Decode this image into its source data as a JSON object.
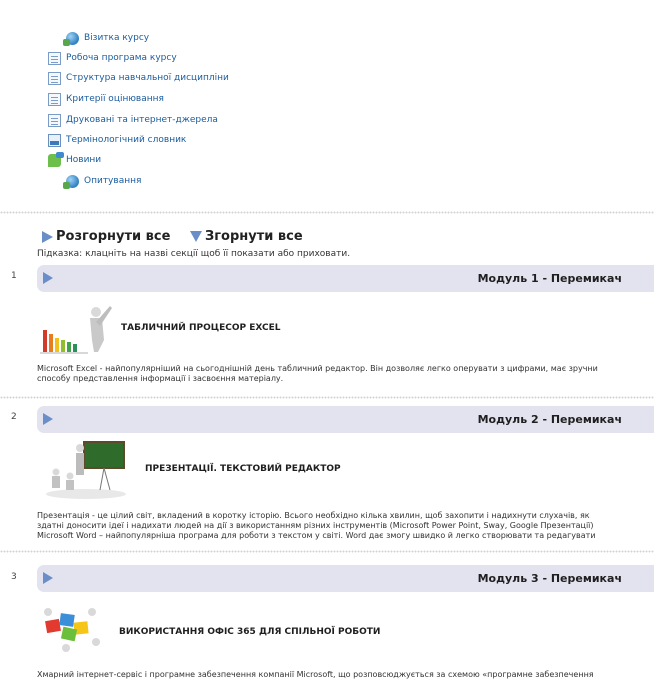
{
  "resources": [
    {
      "label": "Візитка курсу",
      "icon": "globe-icon"
    },
    {
      "label": "Робоча програма курсу",
      "icon": "document-icon"
    },
    {
      "label": "Структура навчальної дисципліни",
      "icon": "document-icon"
    },
    {
      "label": "Критерії оцінювання",
      "icon": "document-icon"
    },
    {
      "label": "Друковані та інтернет-джерела",
      "icon": "document-icon"
    },
    {
      "label": "Термінологічний словник",
      "icon": "glossary-icon"
    },
    {
      "label": "Новини",
      "icon": "forum-icon"
    },
    {
      "label": "Опитування",
      "icon": "globe-icon"
    }
  ],
  "controls": {
    "expand_all": "Розгорнути все",
    "collapse_all": "Згорнути все",
    "hint": "Підказка: клацніть на назві секції щоб її показати або приховати."
  },
  "sections": [
    {
      "number": "1",
      "title": "Модуль 1 - Перемикач",
      "heading": "ТАБЛИЧНИЙ ПРОЦЕСОР EXCEL",
      "description_lines": [
        "Microsoft Excel - найпопулярніший на сьогоднішній день табличний редактор. Він дозволяє легко оперувати з цифрами, має зручни",
        "способу представлення інформації і засвоєння матеріалу."
      ]
    },
    {
      "number": "2",
      "title": "Модуль 2 - Перемикач",
      "heading": "ПРЕЗЕНТАЦІЇ. ТЕКСТОВИЙ РЕДАКТОР",
      "description_lines": [
        "Презентація - це цілий світ, вкладений в коротку історію. Всього необхідно кілька хвилин, щоб захопити і надихнути слухачів, як",
        "здатні доносити ідеї і надихати людей на дії з використанням різних інструментів (Microsoft Power Point, Sway, Google Презентації)",
        "Microsoft Word – найпопулярніша програма для роботи з текстом у світі. Word дає змогу швидко й легко створювати та редагувати"
      ]
    },
    {
      "number": "3",
      "title": "Модуль 3 - Перемикач",
      "heading": "ВИКОРИСТАННЯ ОФІС 365 ДЛЯ СПІЛЬНОЇ РОБОТИ",
      "description_lines": [
        "Хмарний інтернет-сервіс і програмне забезпечення компанії Microsoft, що розповсюджується за схемою «програмне забезпечення"
      ]
    }
  ],
  "colors": {
    "link": "#1a5c9e",
    "section_bar": "#e3e3f0",
    "toggle_arrow": "#6a8fc8"
  }
}
